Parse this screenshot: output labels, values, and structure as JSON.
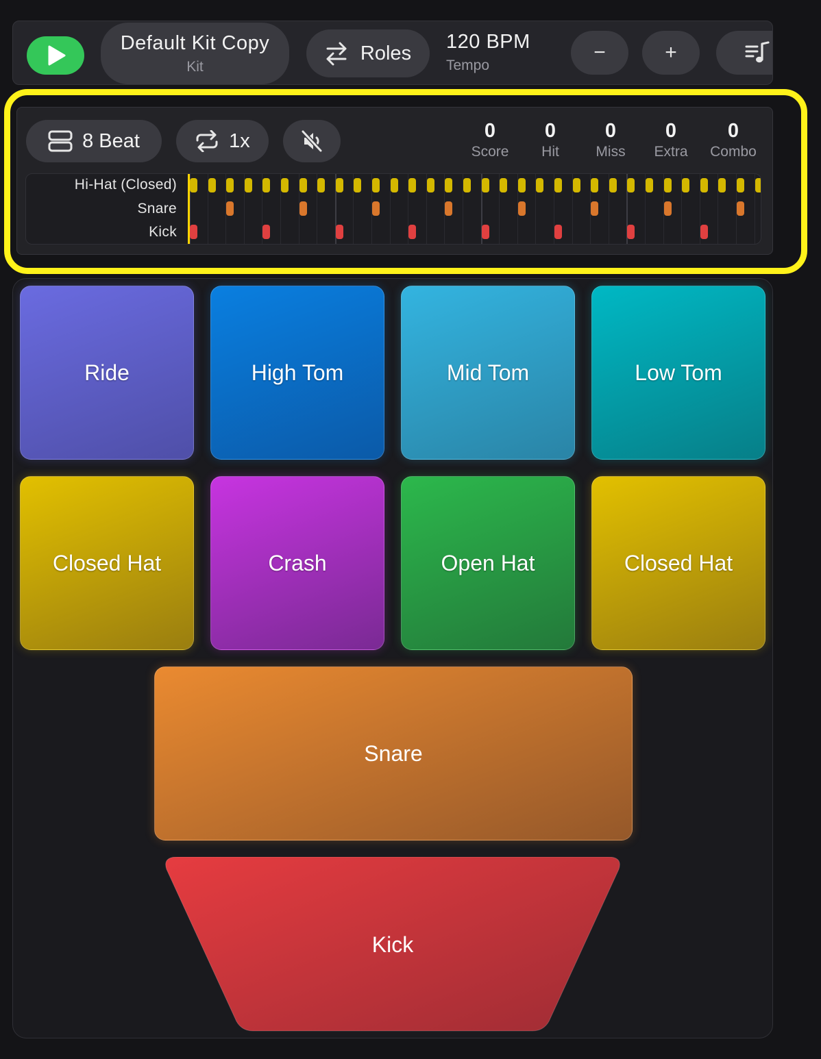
{
  "topbar": {
    "kit_name": "Default Kit Copy",
    "kit_sub": "Kit",
    "roles_label": "Roles",
    "tempo_value": "120 BPM",
    "tempo_sub": "Tempo",
    "minus_label": "−",
    "plus_label": "+"
  },
  "controls": {
    "beat_label": "8 Beat",
    "repeat_label": "1x"
  },
  "stats": [
    {
      "value": "0",
      "label": "Score"
    },
    {
      "value": "0",
      "label": "Hit"
    },
    {
      "value": "0",
      "label": "Miss"
    },
    {
      "value": "0",
      "label": "Extra"
    },
    {
      "value": "0",
      "label": "Combo"
    }
  ],
  "sequencer": {
    "tracks": [
      {
        "label": "Hi-Hat (Closed)",
        "color": "#d4b800",
        "steps": [
          0,
          1,
          2,
          3,
          4,
          5,
          6,
          7,
          8,
          9,
          10,
          11,
          12,
          13,
          14,
          15,
          16,
          17,
          18,
          19,
          20,
          21,
          22,
          23,
          24,
          25,
          26,
          27,
          28,
          29,
          30,
          31
        ]
      },
      {
        "label": "Snare",
        "color": "#d9772c",
        "steps": [
          2,
          6,
          10,
          14,
          18,
          22,
          26,
          30
        ]
      },
      {
        "label": "Kick",
        "color": "#e04040",
        "steps": [
          0,
          4,
          8,
          12,
          16,
          20,
          24,
          28
        ]
      }
    ],
    "total_steps": 32
  },
  "pads": [
    {
      "label": "Ride",
      "colors": [
        "#6a6be0",
        "#4f4fa8"
      ]
    },
    {
      "label": "High Tom",
      "colors": [
        "#0a7fe0",
        "#0b5aa8"
      ]
    },
    {
      "label": "Mid Tom",
      "colors": [
        "#33b4e0",
        "#2a84a6"
      ]
    },
    {
      "label": "Low Tom",
      "colors": [
        "#00b8c4",
        "#077f88"
      ]
    },
    {
      "label": "Closed Hat",
      "colors": [
        "#e2c000",
        "#9a7e10"
      ]
    },
    {
      "label": "Crash",
      "colors": [
        "#c734e0",
        "#7a2a94"
      ]
    },
    {
      "label": "Open Hat",
      "colors": [
        "#2cb84c",
        "#23793a"
      ]
    },
    {
      "label": "Closed Hat",
      "colors": [
        "#e2c000",
        "#9a7e10"
      ]
    }
  ],
  "snare_pad": {
    "label": "Snare",
    "colors": [
      "#ea8a30",
      "#95582a"
    ]
  },
  "kick_pad": {
    "label": "Kick",
    "colors": [
      "#e63c40",
      "#9e2c34"
    ]
  }
}
